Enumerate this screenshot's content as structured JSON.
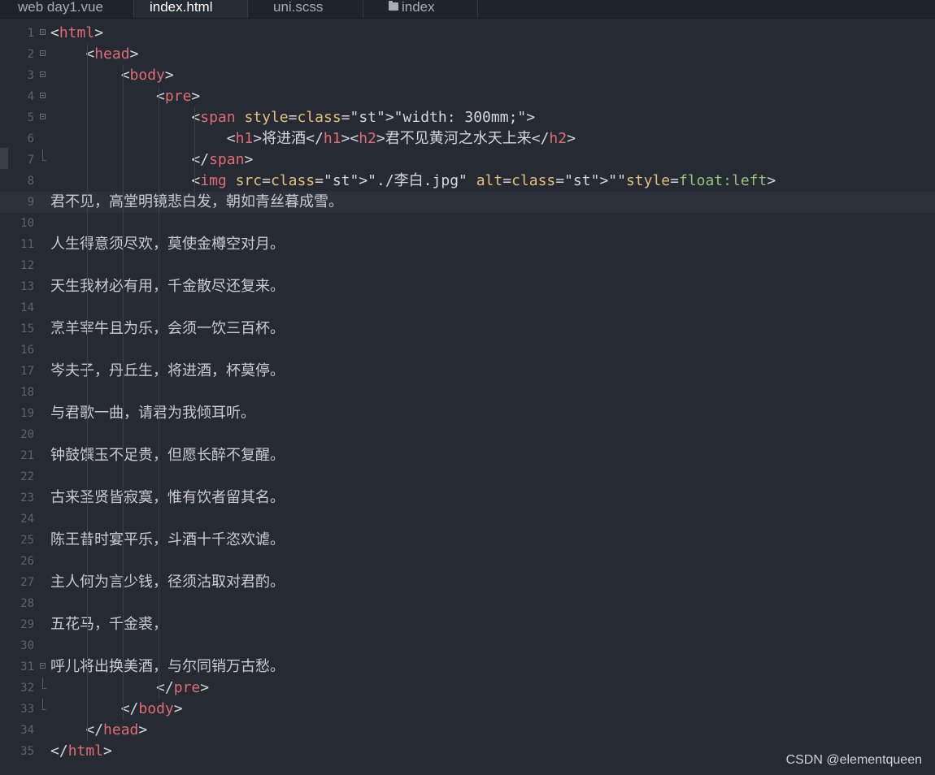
{
  "tabs": [
    {
      "label": "web day1.vue",
      "active": false
    },
    {
      "label": "index.html",
      "active": true
    },
    {
      "label": "uni.scss",
      "active": false
    },
    {
      "label": "index",
      "active": false,
      "icon": "folder-icon"
    }
  ],
  "editor": {
    "current_line": 9,
    "lines": [
      {
        "n": "1",
        "t": "<html>"
      },
      {
        "n": "2",
        "t": "    <head>"
      },
      {
        "n": "3",
        "t": "        <body>"
      },
      {
        "n": "4",
        "t": "            <pre>"
      },
      {
        "n": "5",
        "t": "                <span style=\"width: 300mm;\">"
      },
      {
        "n": "6",
        "t": "                    <h1>将进酒</h1><h2>君不见黄河之水天上来</h2>"
      },
      {
        "n": "7",
        "t": "                </span>"
      },
      {
        "n": "8",
        "t": "                <img src=\"./李白.jpg\" alt=\"\"style=float:left>"
      },
      {
        "n": "9",
        "t": "君不见，高堂明镜悲白发，朝如青丝暮成雪。"
      },
      {
        "n": "10",
        "t": ""
      },
      {
        "n": "11",
        "t": "人生得意须尽欢，莫使金樽空对月。"
      },
      {
        "n": "12",
        "t": ""
      },
      {
        "n": "13",
        "t": "天生我材必有用，千金散尽还复来。"
      },
      {
        "n": "14",
        "t": ""
      },
      {
        "n": "15",
        "t": "烹羊宰牛且为乐，会须一饮三百杯。"
      },
      {
        "n": "16",
        "t": ""
      },
      {
        "n": "17",
        "t": "岑夫子，丹丘生，将进酒，杯莫停。"
      },
      {
        "n": "18",
        "t": ""
      },
      {
        "n": "19",
        "t": "与君歌一曲，请君为我倾耳听。"
      },
      {
        "n": "20",
        "t": ""
      },
      {
        "n": "21",
        "t": "钟鼓馔玉不足贵，但愿长醉不复醒。"
      },
      {
        "n": "22",
        "t": ""
      },
      {
        "n": "23",
        "t": "古来圣贤皆寂寞，惟有饮者留其名。"
      },
      {
        "n": "24",
        "t": ""
      },
      {
        "n": "25",
        "t": "陈王昔时宴平乐，斗酒十千恣欢谑。"
      },
      {
        "n": "26",
        "t": ""
      },
      {
        "n": "27",
        "t": "主人何为言少钱，径须沽取对君酌。"
      },
      {
        "n": "28",
        "t": ""
      },
      {
        "n": "29",
        "t": "五花马，千金裘，"
      },
      {
        "n": "30",
        "t": ""
      },
      {
        "n": "31",
        "t": "呼儿将出换美酒，与尔同销万古愁。"
      },
      {
        "n": "32",
        "t": "            </pre>"
      },
      {
        "n": "33",
        "t": "        </body>"
      },
      {
        "n": "34",
        "t": "    </head>"
      },
      {
        "n": "35",
        "t": "</html>"
      }
    ]
  },
  "watermark": "CSDN @elementqueen"
}
